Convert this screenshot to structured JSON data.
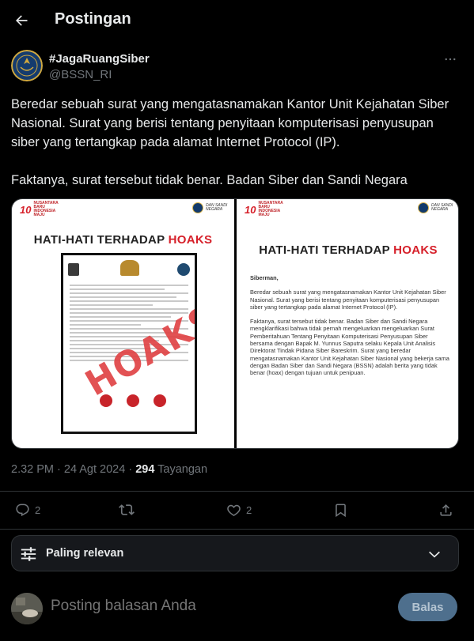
{
  "header": {
    "title": "Postingan",
    "back_icon": "arrow-left-icon"
  },
  "tweet": {
    "author_name": "#JagaRuangSiber",
    "author_handle": "@BSSN_RI",
    "text": "Beredar sebuah surat yang mengatasnamakan Kantor Unit Kejahatan Siber Nasional. Surat yang berisi tentang penyitaan komputerisasi penyusupan siber yang tertangkap pada alamat Internet Protocol (IP).\n\nFaktanya, surat tersebut tidak benar. Badan Siber dan Sandi Negara",
    "timestamp": "2.32 PM · 24 Agt 2024 · ",
    "views_count": "294",
    "views_label": " Tayangan"
  },
  "media": {
    "left": {
      "brand_logo_text": "10",
      "brand_tagline": "NUSANTARA BARU INDONESIA MAJU",
      "partner_text": "DAN SANDI NEGARA",
      "title_prefix": "HATI-HATI TERHADAP ",
      "title_highlight": "HOAKS",
      "stamp_text": "HOAKS"
    },
    "right": {
      "brand_logo_text": "10",
      "brand_tagline": "NUSANTARA BARU INDONESIA MAJU",
      "partner_text": "DAN SANDI NEGARA",
      "title_prefix": "HATI-HATI TERHADAP ",
      "title_highlight": "HOAKS",
      "greeting": "Siberman,",
      "para1": "Beredar sebuah surat yang mengatasnamakan Kantor Unit Kejahatan Siber Nasional. Surat yang berisi tentang penyitaan komputerisasi penyusupan siber yang tertangkap pada alamat Internet Protocol (IP).",
      "para2": "Faktanya, surat tersebut tidak benar. Badan Siber dan Sandi Negara mengklarifikasi bahwa tidak pernah mengeluarkan mengeluarkan Surat Pemberitahuan Tentang Penyitaan Komputerisasi Penyusupan Siber bersama dengan Bapak M. Yunnus Saputra selaku Kepala Unit Analisis Direktorat Tindak Pidana Siber Bareskrim. Surat yang beredar mengatasnamakan Kantor Unit Kejahatan Siber Nasional yang bekerja sama dengan Badan Siber dan Sandi Negara (BSSN) adalah berita yang tidak benar (hoax) dengan tujuan untuk penipuan."
    }
  },
  "actions": {
    "replies": "2",
    "retweets": "",
    "likes": "2",
    "icons": [
      "reply-icon",
      "retweet-icon",
      "like-icon",
      "bookmark-icon",
      "share-icon"
    ]
  },
  "filter": {
    "label": "Paling relevan"
  },
  "reply_box": {
    "placeholder": "Posting balasan Anda",
    "button_label": "Balas"
  },
  "colors": {
    "background": "#000000",
    "text_primary": "#e7e9ea",
    "text_secondary": "#71767b",
    "divider": "#2f3336",
    "hoaks_red": "#d6202a",
    "reply_button": "#4e6f8d"
  }
}
